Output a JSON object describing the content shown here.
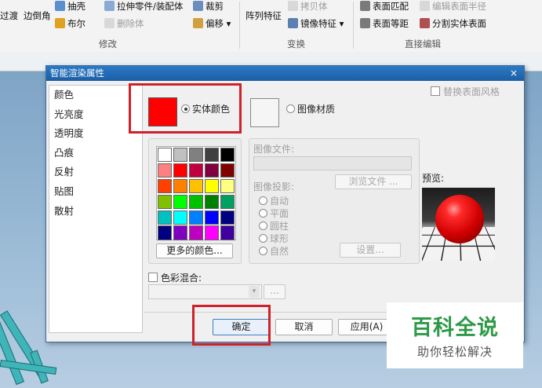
{
  "ribbon": {
    "row1": [
      {
        "label": "抽壳",
        "icon": "shell-icon",
        "enabled": true
      },
      {
        "label": "拉伸零件/装配体",
        "icon": "extrude-part-icon",
        "enabled": true
      },
      {
        "label": "裁剪",
        "icon": "trim-icon",
        "enabled": true
      },
      {
        "label": "拷贝体",
        "icon": "copy-body-icon",
        "enabled": false
      },
      {
        "label": "表面匹配",
        "icon": "surface-match-icon",
        "enabled": true
      },
      {
        "label": "编辑表面半径",
        "icon": "edit-radius-icon",
        "enabled": false
      }
    ],
    "row2": [
      {
        "label": "布尔",
        "icon": "boolean-icon",
        "enabled": true
      },
      {
        "label": "删除体",
        "icon": "delete-body-icon",
        "enabled": false
      },
      {
        "label": "偏移 ▾",
        "icon": "offset-icon",
        "enabled": true
      },
      {
        "label": "镜像特征 ▾",
        "icon": "mirror-feature-icon",
        "enabled": true
      },
      {
        "label": "表面等距",
        "icon": "surface-offset-icon",
        "enabled": true
      },
      {
        "label": "分割实体表面",
        "icon": "split-face-icon",
        "enabled": true
      }
    ],
    "large": [
      "过渡",
      "边倒角",
      "阵列特征"
    ],
    "groups": [
      "修改",
      "变换",
      "直接编辑"
    ]
  },
  "dialog": {
    "title": "智能渲染属性",
    "close": "×",
    "nav": [
      "颜色",
      "光亮度",
      "透明度",
      "凸痕",
      "反射",
      "贴图",
      "散射"
    ],
    "solid_color_label": "实体颜色",
    "image_material_label": "图像材质",
    "replace_style_label": "替换表面风格",
    "more_colors": "更多的颜色...",
    "image_file_label": "图像文件:",
    "browse_label": "浏览文件 ...",
    "projection_label": "图像投影:",
    "projection_options": [
      "自动",
      "平面",
      "圆柱",
      "球形",
      "自然"
    ],
    "settings_label": "设置...",
    "preview_label": "预览:",
    "color_blend_label": "色彩混合:",
    "ellipsis": "...",
    "ok": "确定",
    "cancel": "取消",
    "apply": "应用(A)"
  },
  "palette": [
    "#ffffff",
    "#c0c0c0",
    "#808080",
    "#404040",
    "#000000",
    "#ff8080",
    "#ff0000",
    "#c00040",
    "#800040",
    "#800000",
    "#ff4000",
    "#ff8000",
    "#ffc000",
    "#ffff00",
    "#ffff80",
    "#80c000",
    "#00ff00",
    "#00c000",
    "#008000",
    "#00a060",
    "#00c0c0",
    "#00ffff",
    "#0080ff",
    "#0000ff",
    "#000080",
    "#000080",
    "#8000c0",
    "#c000c0",
    "#ff00ff",
    "#4000a0"
  ],
  "selected_color": "#ff0000",
  "watermark": {
    "title": "百科全说",
    "subtitle": "助你轻松解决"
  }
}
